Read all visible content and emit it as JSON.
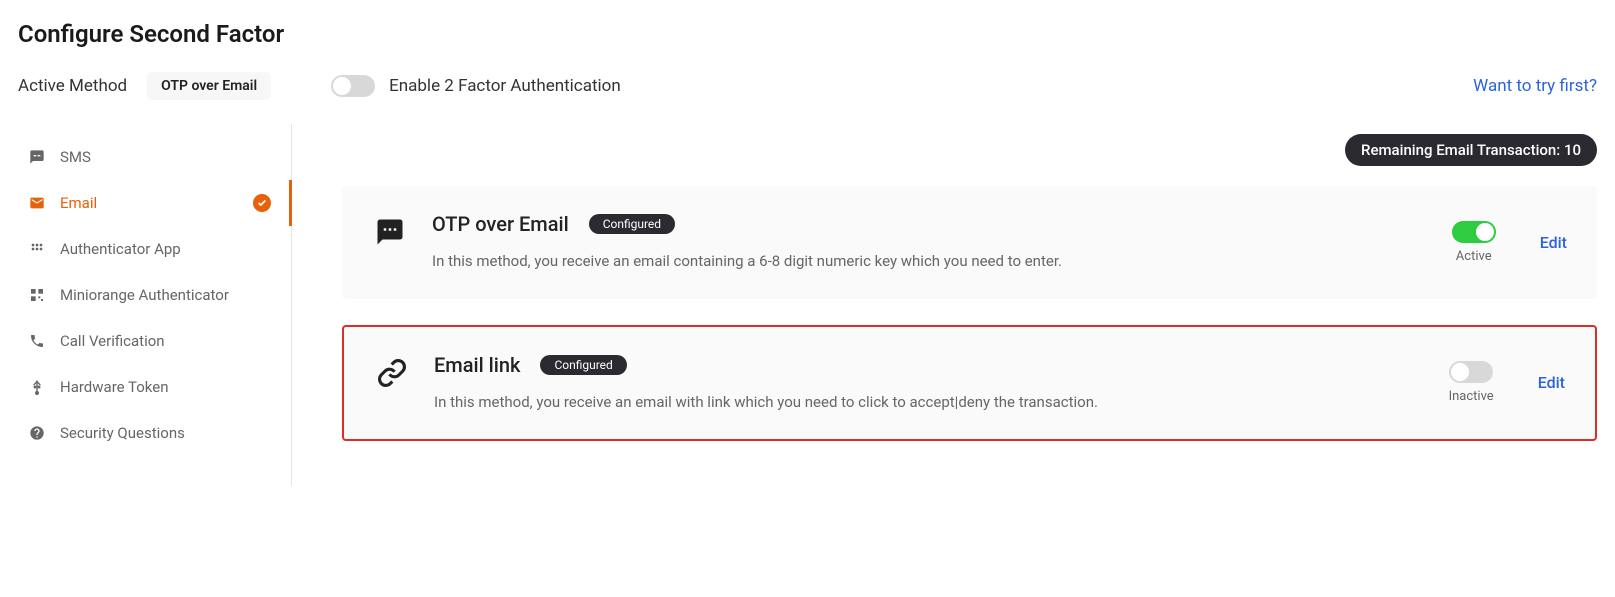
{
  "page": {
    "title": "Configure Second Factor",
    "active_method_label": "Active Method",
    "active_method_value": "OTP over Email",
    "enable_2fa_label": "Enable 2 Factor Authentication",
    "try_link": "Want to try first?"
  },
  "sidebar": {
    "items": [
      {
        "label": "SMS"
      },
      {
        "label": "Email"
      },
      {
        "label": "Authenticator App"
      },
      {
        "label": "Miniorange Authenticator"
      },
      {
        "label": "Call Verification"
      },
      {
        "label": "Hardware Token"
      },
      {
        "label": "Security Questions"
      }
    ]
  },
  "main": {
    "remaining_badge": "Remaining Email Transaction: 10",
    "methods": [
      {
        "title": "OTP over Email",
        "configured": "Configured",
        "desc": "In this method, you receive an email containing a 6-8 digit numeric key which you need to enter.",
        "status": "Active",
        "edit": "Edit"
      },
      {
        "title": "Email link",
        "configured": "Configured",
        "desc": "In this method, you receive an email with link which you need to click to accept|deny the transaction.",
        "status": "Inactive",
        "edit": "Edit"
      }
    ]
  }
}
